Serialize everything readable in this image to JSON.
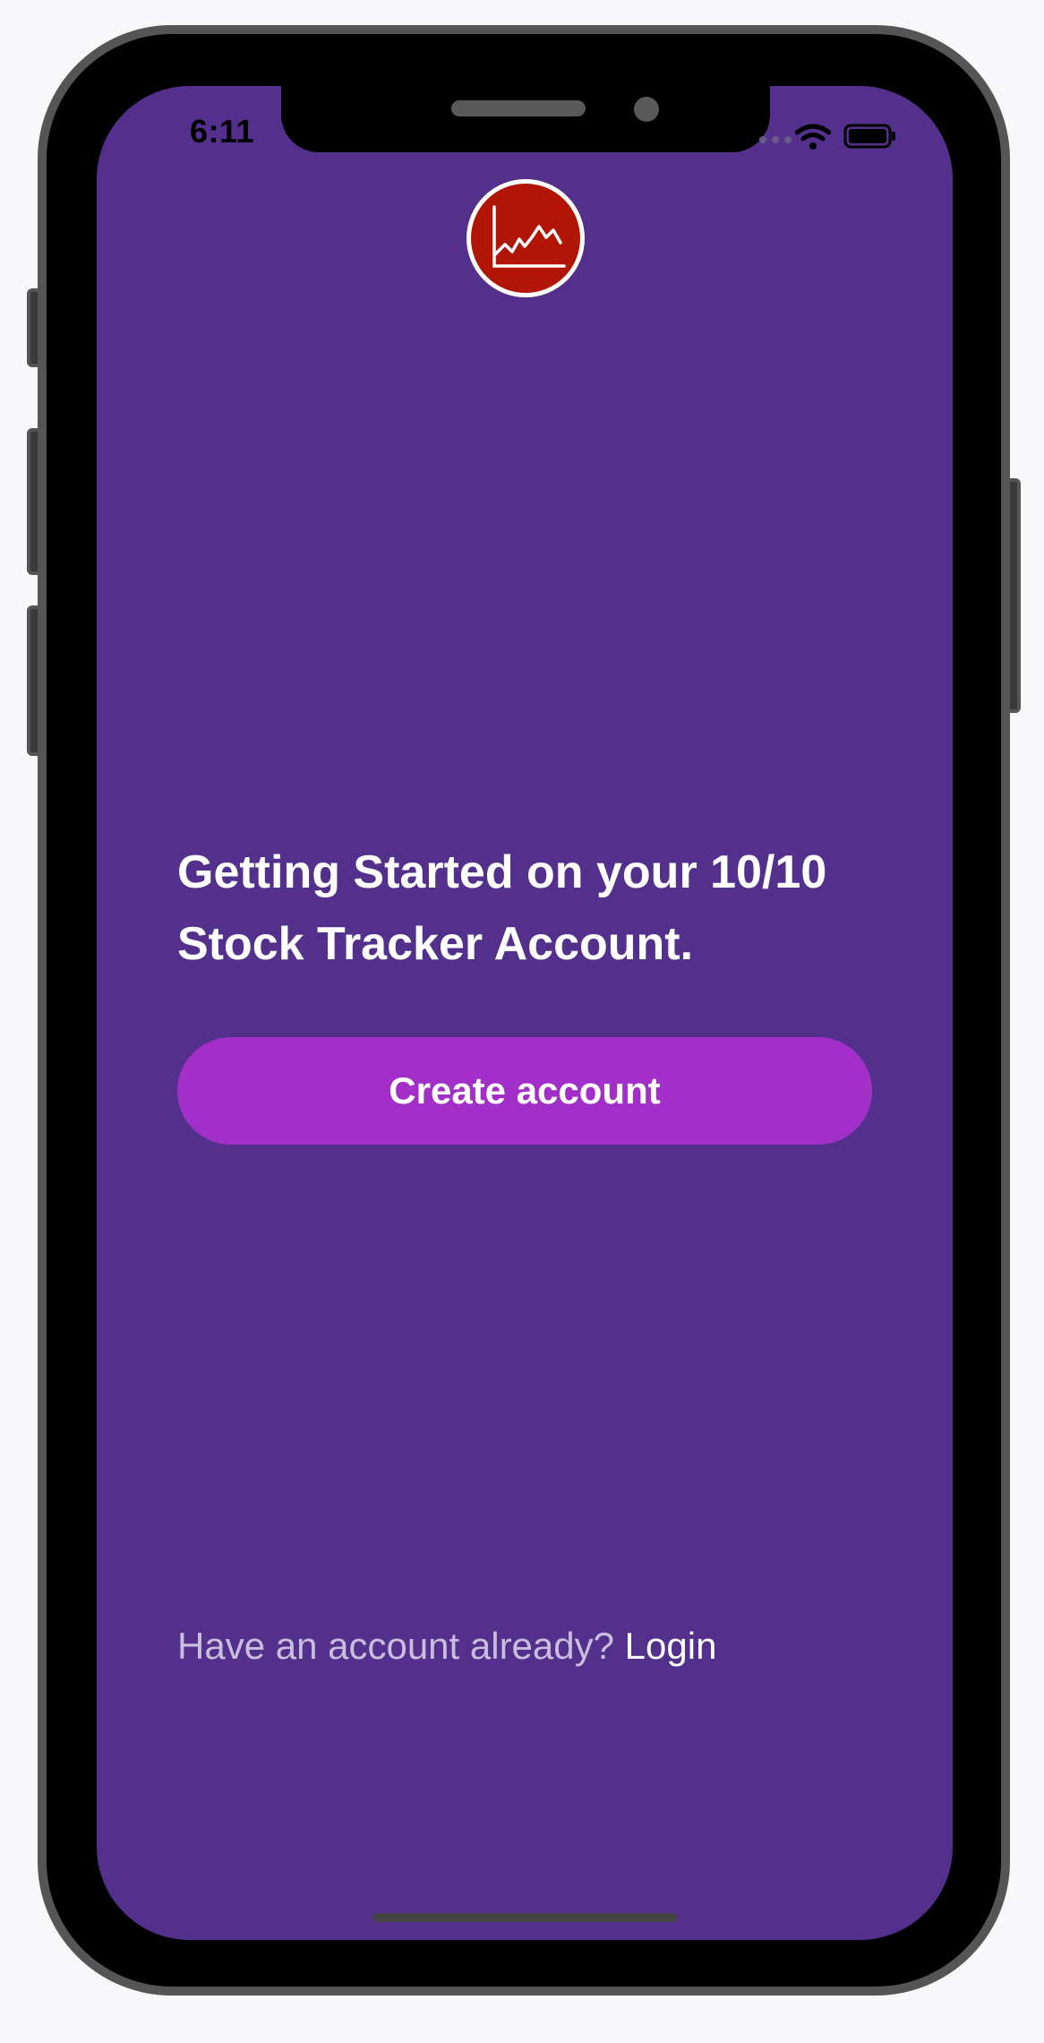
{
  "status_bar": {
    "time": "6:11"
  },
  "logo": {
    "icon": "stock-chart-icon",
    "color": "#b01505"
  },
  "main": {
    "heading": "Getting Started on your 10/10 Stock Tracker Account.",
    "create_button_label": "Create account"
  },
  "footer": {
    "prompt": "Have an account already? ",
    "login_label": "Login"
  },
  "colors": {
    "background": "#52308b",
    "button": "#a230c8",
    "text": "#ffffff",
    "muted_text": "#c9bedd"
  }
}
